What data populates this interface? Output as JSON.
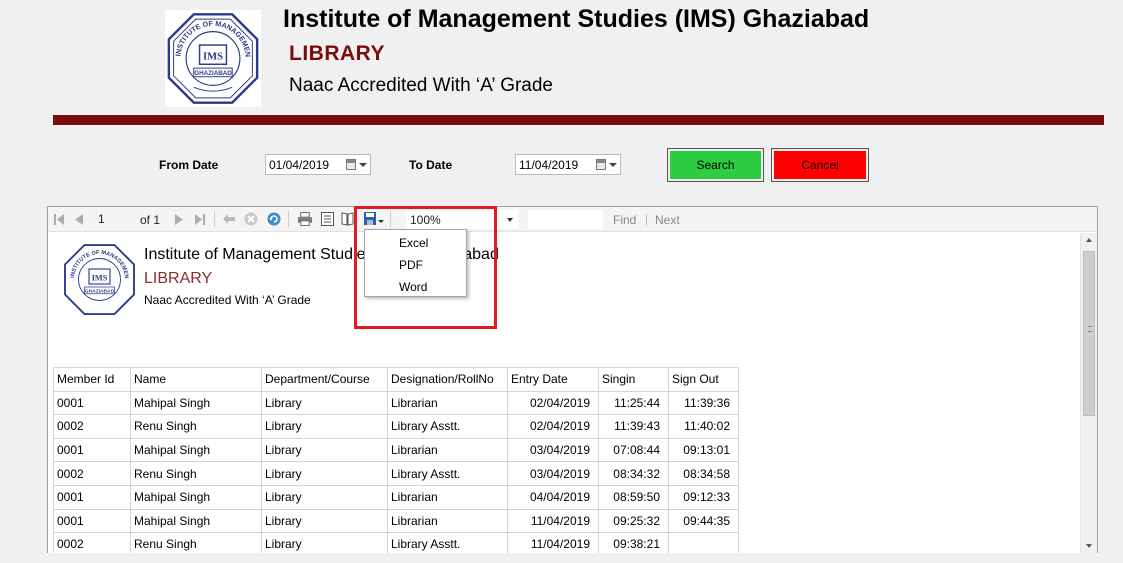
{
  "header": {
    "title": "Institute of Management Studies (IMS) Ghaziabad",
    "library": "LIBRARY",
    "accreditation": "Naac Accredited With ‘A’ Grade"
  },
  "logo": {
    "ring_text": "INSTITUTE OF MANAGEMENT STUDIES",
    "center": "IMS",
    "city": "GHAZIABAD"
  },
  "filters": {
    "from_label": "From Date",
    "from_value": "01/04/2019",
    "to_label": "To Date",
    "to_value": "11/04/2019",
    "search_label": "Search",
    "cancel_label": "Cancel"
  },
  "colors": {
    "banner": "#7a0b0e",
    "search_button": "#2ecc40",
    "cancel_button": "#ff0000",
    "highlight": "#e21b22"
  },
  "toolbar": {
    "page_current": "1",
    "page_of": "of 1",
    "zoom": "100%",
    "find": "Find",
    "separator": "|",
    "next": "Next",
    "icons": [
      "first-page-icon",
      "previous-page-icon",
      "next-page-icon",
      "last-page-icon",
      "back-icon",
      "stop-icon",
      "refresh-icon",
      "print-icon",
      "print-layout-icon",
      "page-setup-icon",
      "export-icon"
    ]
  },
  "export_menu": {
    "items": [
      "Excel",
      "PDF",
      "Word"
    ]
  },
  "report": {
    "title": "Institute of Management Studies (IMS) Ghaziabad",
    "library": "LIBRARY",
    "accreditation": "Naac Accredited With ‘A’ Grade",
    "columns": [
      "Member Id",
      "Name",
      "Department/Course",
      "Designation/RollNo",
      "Entry Date",
      "Singin",
      "Sign Out"
    ],
    "rows": [
      [
        "0001",
        "Mahipal Singh",
        "Library",
        "Librarian",
        "02/04/2019",
        "11:25:44",
        "11:39:36"
      ],
      [
        "0002",
        "Renu Singh",
        "Library",
        "Library Asstt.",
        "02/04/2019",
        "11:39:43",
        "11:40:02"
      ],
      [
        "0001",
        "Mahipal Singh",
        "Library",
        "Librarian",
        "03/04/2019",
        "07:08:44",
        "09:13:01"
      ],
      [
        "0002",
        "Renu Singh",
        "Library",
        "Library Asstt.",
        "03/04/2019",
        "08:34:32",
        "08:34:58"
      ],
      [
        "0001",
        "Mahipal Singh",
        "Library",
        "Librarian",
        "04/04/2019",
        "08:59:50",
        "09:12:33"
      ],
      [
        "0001",
        "Mahipal Singh",
        "Library",
        "Librarian",
        "11/04/2019",
        "09:25:32",
        "09:44:35"
      ],
      [
        "0002",
        "Renu Singh",
        "Library",
        "Library Asstt.",
        "11/04/2019",
        "09:38:21",
        ""
      ]
    ]
  }
}
